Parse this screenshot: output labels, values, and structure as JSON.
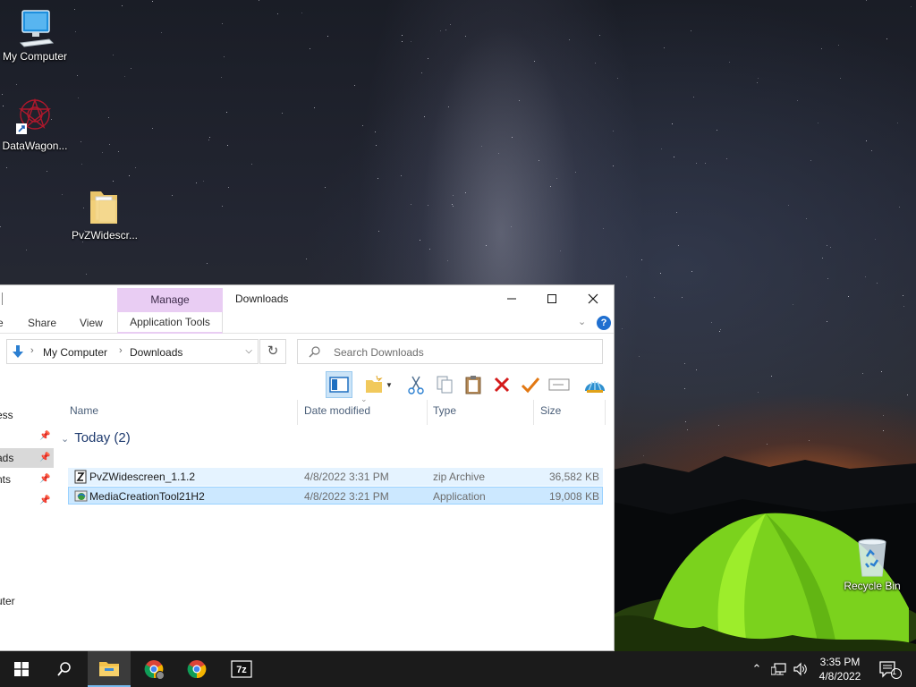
{
  "desktop": {
    "icons": [
      {
        "label": "My Computer",
        "icon": "computer-icon"
      },
      {
        "label": "DataWagon...",
        "icon": "datawagon-shortcut-icon"
      },
      {
        "label": "PvZWidescr...",
        "icon": "folder-icon"
      },
      {
        "label": "Recycle Bin",
        "icon": "recycle-bin-icon"
      }
    ]
  },
  "explorer": {
    "title": "Downloads",
    "context_tab": "Manage",
    "ribbon_tabs": [
      "e",
      "Share",
      "View",
      "Application Tools"
    ],
    "address": {
      "crumbs": [
        "My Computer",
        "Downloads"
      ]
    },
    "search": {
      "placeholder": "Search Downloads"
    },
    "nav_items": [
      "ess",
      "ads",
      "nts",
      "",
      "uter"
    ],
    "columns": [
      "Name",
      "Date modified",
      "Type",
      "Size"
    ],
    "group": {
      "label": "Today (2)"
    },
    "files": [
      {
        "name": "PvZWidescreen_1.1.2",
        "date": "4/8/2022 3:31 PM",
        "type": "zip Archive",
        "size": "36,582 KB",
        "icon": "zip-archive-icon"
      },
      {
        "name": "MediaCreationTool21H2",
        "date": "4/8/2022 3:21 PM",
        "type": "Application",
        "size": "19,008 KB",
        "icon": "application-icon"
      }
    ]
  },
  "taskbar": {
    "clock_time": "3:35 PM",
    "clock_date": "4/8/2022",
    "notification_count": "1",
    "accent": "#76b9ed"
  },
  "colors": {
    "context_tab": "#e9cdf3",
    "selection": "#cce8ff",
    "hover": "#e5f3ff"
  }
}
